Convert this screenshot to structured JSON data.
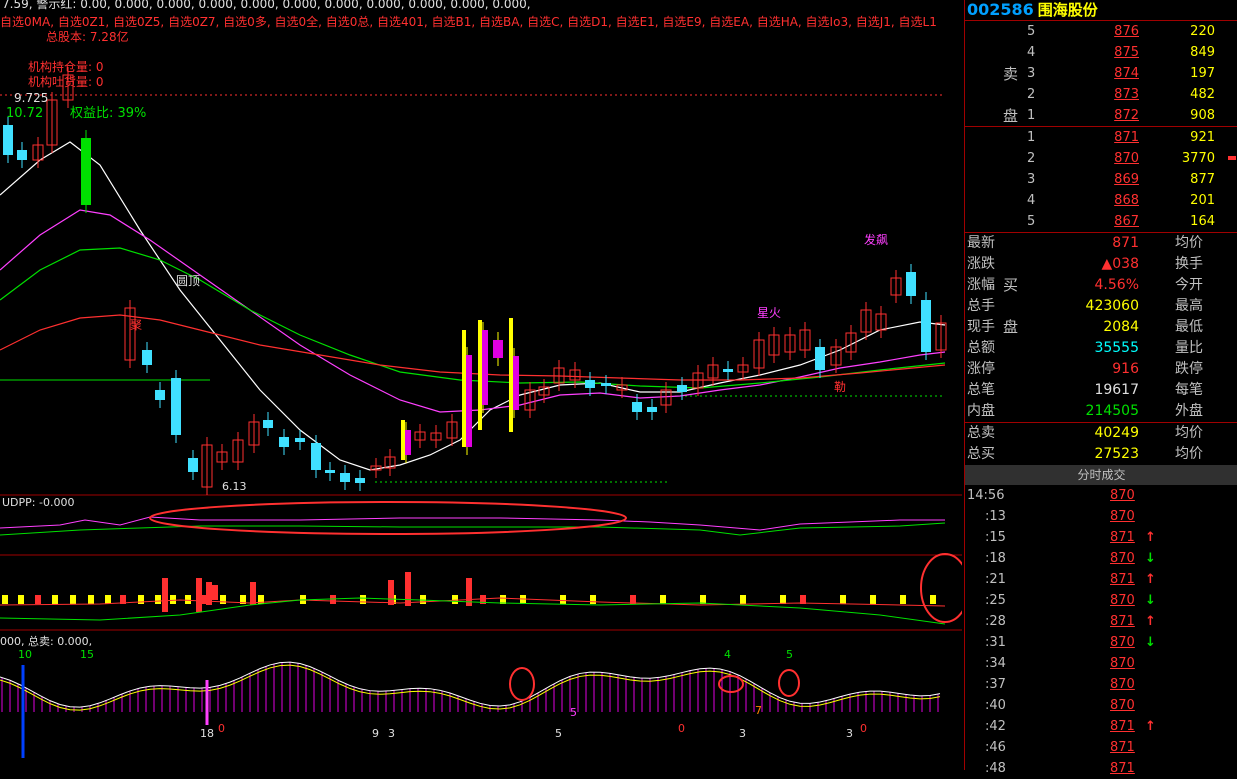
{
  "stock": {
    "code": "002586",
    "name": "围海股份"
  },
  "chart": {
    "legend_line": "7.59, 警示红: 0.00, 0.000, 0.000, 0.000, 0.000, 0.000, 0.000, 0.000, 0.000, 0.000, 0.000,",
    "selections_line": "自选0MA, 自选0Z1, 自选0Z5, 自选0Z7, 自选0多, 自选0全, 自选0总, 自选401, 自选B1, 自选BA, 自选C, 自选D1, 自选E1, 自选E9, 自选EA, 自选HA, 自选Io3, 自选J1, 自选L1",
    "total_share": "总股本: 7.28亿",
    "inst_hold": "机构持仓量: 0",
    "inst_vol": "机构吐货量: 0",
    "price_high": "9.725",
    "price_prev": "10.72",
    "equity_ratio": "权益比: 39%",
    "label_round_top": "圆顶",
    "label_low": "6.13",
    "label_star_fire": "星火",
    "label_launch": "发飙",
    "label_gather": "聚",
    "label_exit": "勒",
    "udpp": "UDPP: -0.000",
    "bottom_legend": "000, 总卖: 0.000,",
    "bottom_num_10": "10",
    "bottom_num_15": "15",
    "bottom_labels": [
      "18",
      "0",
      "9",
      "3",
      "5",
      "5",
      "0",
      "3",
      "7",
      "4",
      "5",
      "3",
      "0"
    ]
  },
  "order_book": {
    "sell_label_1": "卖",
    "sell_label_2": "盘",
    "buy_label_1": "买",
    "buy_label_2": "盘",
    "sells": [
      {
        "level": "5",
        "price": "876",
        "volume": "220"
      },
      {
        "level": "4",
        "price": "875",
        "volume": "849"
      },
      {
        "level": "3",
        "price": "874",
        "volume": "197"
      },
      {
        "level": "2",
        "price": "873",
        "volume": "482"
      },
      {
        "level": "1",
        "price": "872",
        "volume": "908"
      }
    ],
    "buys": [
      {
        "level": "1",
        "price": "871",
        "volume": "921"
      },
      {
        "level": "2",
        "price": "870",
        "volume": "3770"
      },
      {
        "level": "3",
        "price": "869",
        "volume": "877"
      },
      {
        "level": "4",
        "price": "868",
        "volume": "201"
      },
      {
        "level": "5",
        "price": "867",
        "volume": "164"
      }
    ]
  },
  "stats": [
    {
      "label": "最新",
      "value": "871",
      "value_color": "#ff3030",
      "label2": "均价"
    },
    {
      "label": "涨跌",
      "value": "▲038",
      "value_color": "#ff3030",
      "label2": "换手"
    },
    {
      "label": "涨幅",
      "value": "4.56%",
      "value_color": "#ff3030",
      "label2": "今开"
    },
    {
      "label": "总手",
      "value": "423060",
      "value_color": "#ffff00",
      "label2": "最高"
    },
    {
      "label": "现手",
      "value": "2084",
      "value_color": "#ffff00",
      "label2": "最低"
    },
    {
      "label": "总额",
      "value": "35555",
      "value_color": "#00ffff",
      "label2": "量比"
    },
    {
      "label": "涨停",
      "value": "916",
      "value_color": "#ff3030",
      "label2": "跌停"
    },
    {
      "label": "总笔",
      "value": "19617",
      "value_color": "#e0e0e0",
      "label2": "每笔"
    },
    {
      "label": "内盘",
      "value": "214505",
      "value_color": "#00e000",
      "label2": "外盘"
    },
    {
      "label": "总卖",
      "value": "40249",
      "value_color": "#ffff00",
      "label2": "均价"
    },
    {
      "label": "总买",
      "value": "27523",
      "value_color": "#ffff00",
      "label2": "均价"
    }
  ],
  "ticks_header": "分时成交",
  "ticks": [
    {
      "time": "14:56",
      "price": "870",
      "arrow": ""
    },
    {
      "time": ":13",
      "price": "870",
      "arrow": ""
    },
    {
      "time": ":15",
      "price": "871",
      "arrow": "↑"
    },
    {
      "time": ":18",
      "price": "870",
      "arrow": "↓"
    },
    {
      "time": ":21",
      "price": "871",
      "arrow": "↑"
    },
    {
      "time": ":25",
      "price": "870",
      "arrow": "↓"
    },
    {
      "time": ":28",
      "price": "871",
      "arrow": "↑"
    },
    {
      "time": ":31",
      "price": "870",
      "arrow": "↓"
    },
    {
      "time": ":34",
      "price": "870",
      "arrow": ""
    },
    {
      "time": ":37",
      "price": "870",
      "arrow": ""
    },
    {
      "time": ":40",
      "price": "870",
      "arrow": ""
    },
    {
      "time": ":42",
      "price": "871",
      "arrow": "↑"
    },
    {
      "time": ":46",
      "price": "871",
      "arrow": ""
    },
    {
      "time": ":48",
      "price": "871",
      "arrow": ""
    }
  ],
  "colors": {
    "up": "#ff3030",
    "down": "#00e000",
    "bg": "#000000",
    "accent": "#00a0ff"
  }
}
